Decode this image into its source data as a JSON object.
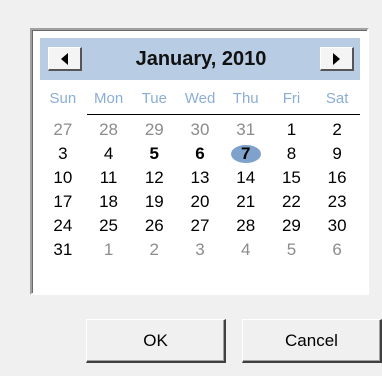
{
  "calendar": {
    "title": "January, 2010",
    "prev_icon": "triangle-left",
    "next_icon": "triangle-right",
    "weekdays": [
      "Sun",
      "Mon",
      "Tue",
      "Wed",
      "Thu",
      "Fri",
      "Sat"
    ],
    "header_color": "#b8cce4",
    "weekday_color": "#8aaed6",
    "selection_color": "#7fa2cc",
    "days": [
      {
        "d": "27",
        "other": true
      },
      {
        "d": "28",
        "other": true
      },
      {
        "d": "29",
        "other": true
      },
      {
        "d": "30",
        "other": true
      },
      {
        "d": "31",
        "other": true
      },
      {
        "d": "1"
      },
      {
        "d": "2"
      },
      {
        "d": "3"
      },
      {
        "d": "4"
      },
      {
        "d": "5",
        "bold": true
      },
      {
        "d": "6",
        "bold": true
      },
      {
        "d": "7",
        "bold": true,
        "selected": true
      },
      {
        "d": "8"
      },
      {
        "d": "9"
      },
      {
        "d": "10"
      },
      {
        "d": "11"
      },
      {
        "d": "12"
      },
      {
        "d": "13"
      },
      {
        "d": "14"
      },
      {
        "d": "15"
      },
      {
        "d": "16"
      },
      {
        "d": "17"
      },
      {
        "d": "18"
      },
      {
        "d": "19"
      },
      {
        "d": "20"
      },
      {
        "d": "21"
      },
      {
        "d": "22"
      },
      {
        "d": "23"
      },
      {
        "d": "24"
      },
      {
        "d": "25"
      },
      {
        "d": "26"
      },
      {
        "d": "27"
      },
      {
        "d": "28"
      },
      {
        "d": "29"
      },
      {
        "d": "30"
      },
      {
        "d": "31"
      },
      {
        "d": "1",
        "other": true
      },
      {
        "d": "2",
        "other": true
      },
      {
        "d": "3",
        "other": true
      },
      {
        "d": "4",
        "other": true
      },
      {
        "d": "5",
        "other": true
      },
      {
        "d": "6",
        "other": true
      }
    ]
  },
  "buttons": {
    "ok_label": "OK",
    "cancel_label": "Cancel"
  }
}
